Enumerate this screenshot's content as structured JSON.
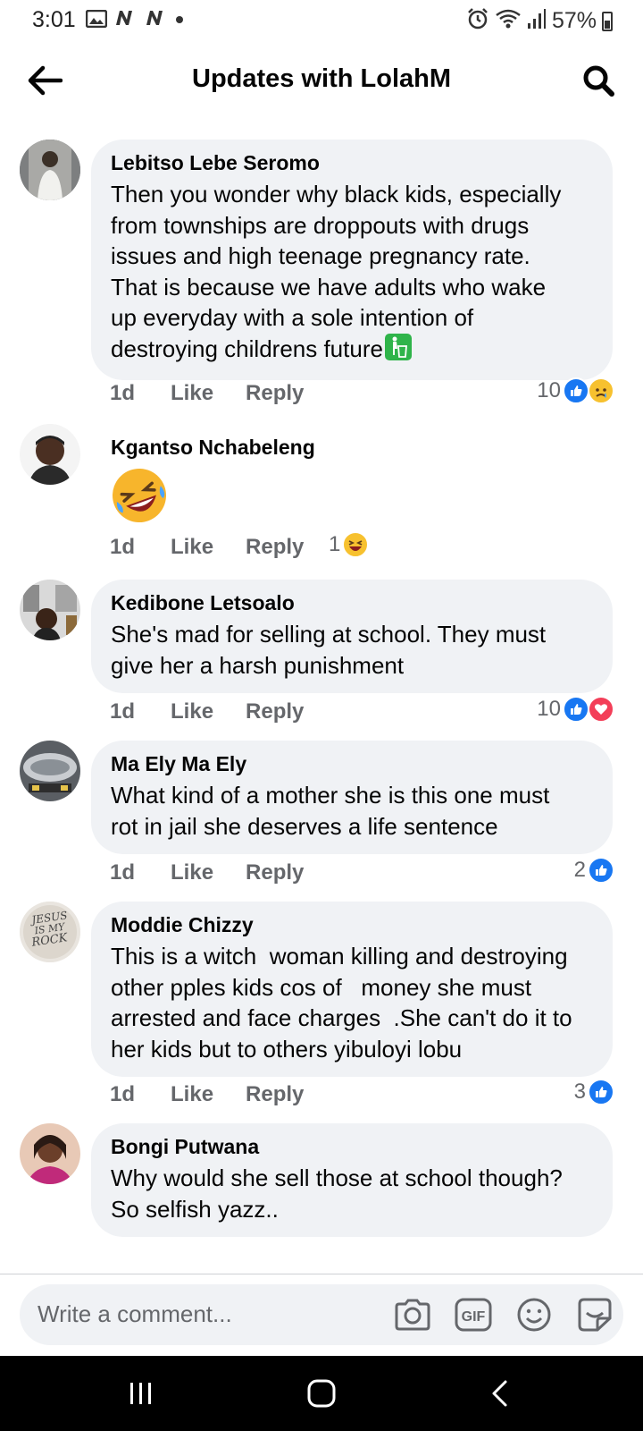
{
  "status_bar": {
    "time": "3:01",
    "battery": "57%",
    "left_icons": [
      "gallery-icon",
      "n-icon",
      "n-icon",
      "dot-icon"
    ],
    "right_icons": [
      "alarm-icon",
      "wifi-icon",
      "signal-icon",
      "battery-icon"
    ]
  },
  "header": {
    "title": "Updates with LolahM",
    "back_icon": "back-arrow-icon",
    "search_icon": "search-icon"
  },
  "actions": {
    "like": "Like",
    "reply": "Reply"
  },
  "comments": [
    {
      "author": "Lebitso Lebe Seromo",
      "text": "Then you wonder why black kids, especially\nfrom townships are droppouts with drugs\nissues and high teenage pregnancy rate.\nThat is because we have adults who wake\nup everyday with a sole intention of\ndestroying childrens future",
      "text_emoji": "wastebasket-emoji-icon",
      "time": "1d",
      "reaction_count": "10",
      "reactions": [
        "like-reaction-icon",
        "sad-reaction-icon"
      ]
    },
    {
      "author": "Kgantso Nchabeleng",
      "emoji": "rolling-laughing-emoji-icon",
      "time": "1d",
      "reaction_count": "1",
      "reactions": [
        "haha-reaction-icon"
      ]
    },
    {
      "author": "Kedibone Letsoalo",
      "text": "She's mad for selling at school. They must\ngive her a harsh punishment",
      "time": "1d",
      "reaction_count": "10",
      "reactions": [
        "like-reaction-icon",
        "love-reaction-icon"
      ]
    },
    {
      "author": "Ma Ely Ma Ely",
      "text": "What kind of a mother she is this one must\nrot in jail she deserves a life sentence",
      "time": "1d",
      "reaction_count": "2",
      "reactions": [
        "like-reaction-icon"
      ]
    },
    {
      "author": "Moddie Chizzy",
      "text": "This is a witch  woman killing and destroying\nother pples kids cos of   money she must\narrested and face charges  .She can't do it to\nher kids but to others yibuloyi lobu",
      "avatar_text": "JESUS IS MY ROCK",
      "time": "1d",
      "reaction_count": "3",
      "reactions": [
        "like-reaction-icon"
      ]
    },
    {
      "author": "Bongi Putwana",
      "text": "Why would she sell those at school though?\nSo selfish yazz.."
    }
  ],
  "composer": {
    "placeholder": "Write a comment...",
    "icons": [
      "camera-icon",
      "gif-icon",
      "emoji-icon",
      "sticker-icon"
    ],
    "gif_label": "GIF"
  },
  "colors": {
    "bubble": "#f0f2f5",
    "secondary_text": "#65676b",
    "like_blue": "#1877f2",
    "love_red": "#f33e58",
    "nav_bar": "#000000"
  }
}
